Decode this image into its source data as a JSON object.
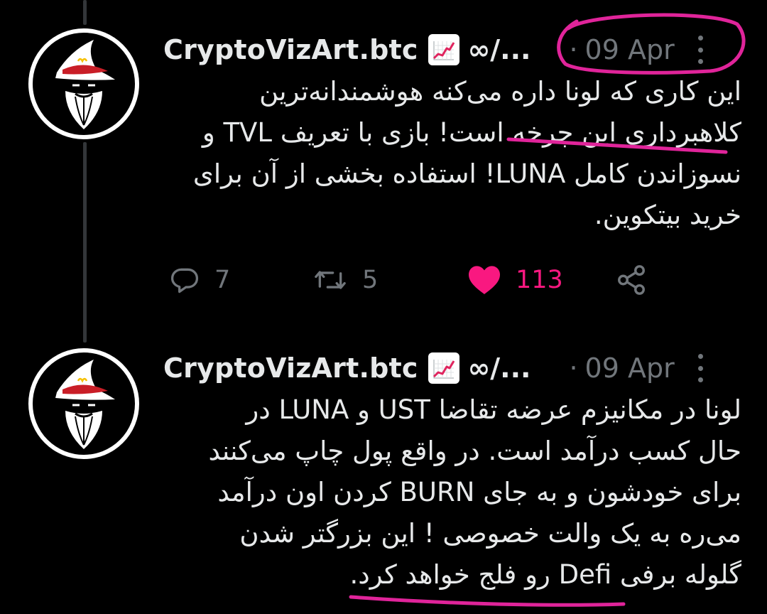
{
  "tweets": [
    {
      "author": "CryptoVizArt.btc",
      "author_suffix": "∞/...",
      "separator": "·",
      "date": "09 Apr",
      "lines": [
        "این کاری که لونا داره می‌کنه هوشمندانه‌ترین",
        "کلاهبرداری این چرخه است! بازی با تعریف TVL و",
        "نسوزاندن کامل LUNA! استفاده بخشی از آن برای",
        "خرید بیتکوین."
      ],
      "replies": "7",
      "retweets": "5",
      "likes": "113"
    },
    {
      "author": "CryptoVizArt.btc",
      "author_suffix": "∞/...",
      "separator": "·",
      "date": "09 Apr",
      "lines": [
        "لونا در مکانیزم عرضه تقاضا UST و LUNA در",
        "حال کسب درآمد است. در واقع پول چاپ می‌کنند",
        "برای خودشون و به جای BURN کردن اون درآمد",
        "می‌ره به یک والت خصوصی ! این بزرگتر شدن",
        "گلوله برفی Defi رو فلج خواهد کرد."
      ]
    }
  ],
  "icons": {
    "avatar": "wizard-avatar-icon",
    "emoji": "chart-increasing-icon",
    "more": "more-vertical-icon",
    "reply": "reply-icon",
    "retweet": "retweet-icon",
    "like": "heart-icon",
    "share": "share-icon"
  },
  "colors": {
    "background": "#000000",
    "text": "#e7e9ea",
    "muted": "#71767b",
    "like": "#f91880",
    "annotation": "#e0249a",
    "thread_line": "#333639"
  }
}
